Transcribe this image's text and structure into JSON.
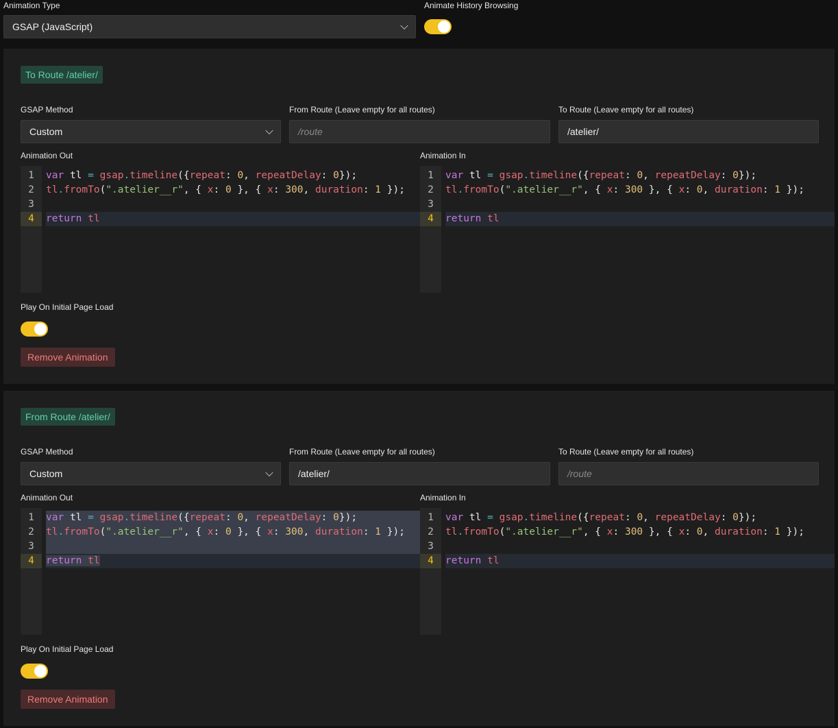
{
  "top": {
    "animation_type_label": "Animation Type",
    "animation_type_value": "GSAP (JavaScript)",
    "history_label": "Animate History Browsing"
  },
  "panels": [
    {
      "tag": "To Route /atelier/",
      "gsap_method_label": "GSAP Method",
      "gsap_method_value": "Custom",
      "from_route_label": "From Route (Leave empty for all routes)",
      "from_route_value": "",
      "from_route_placeholder": "/route",
      "to_route_label": "To Route (Leave empty for all routes)",
      "to_route_value": "/atelier/",
      "to_route_placeholder": "/route",
      "anim_out_label": "Animation Out",
      "anim_in_label": "Animation In",
      "play_label": "Play On Initial Page Load",
      "remove_label": "Remove Animation"
    },
    {
      "tag": "From Route /atelier/",
      "gsap_method_label": "GSAP Method",
      "gsap_method_value": "Custom",
      "from_route_label": "From Route (Leave empty for all routes)",
      "from_route_value": "/atelier/",
      "from_route_placeholder": "/route",
      "to_route_label": "To Route (Leave empty for all routes)",
      "to_route_value": "",
      "to_route_placeholder": "/route",
      "anim_out_label": "Animation Out",
      "anim_in_label": "Animation In",
      "play_label": "Play On Initial Page Load",
      "remove_label": "Remove Animation"
    }
  ],
  "code": {
    "out_lines": [
      "var tl = gsap.timeline({repeat: 0, repeatDelay: 0});",
      "tl.fromTo(\".atelier__r\", { x: 0 }, { x: 300, duration: 1 });",
      "",
      "return tl"
    ],
    "in_lines": [
      "var tl = gsap.timeline({repeat: 0, repeatDelay: 0});",
      "tl.fromTo(\".atelier__r\", { x: 300 }, { x: 0, duration: 1 });",
      "",
      "return tl"
    ],
    "line_numbers": [
      "1",
      "2",
      "3",
      "4"
    ]
  },
  "colors": {
    "accent_yellow": "#f2c01f",
    "tag_green": "#5fd3a6",
    "remove_red": "#f07a7a"
  }
}
